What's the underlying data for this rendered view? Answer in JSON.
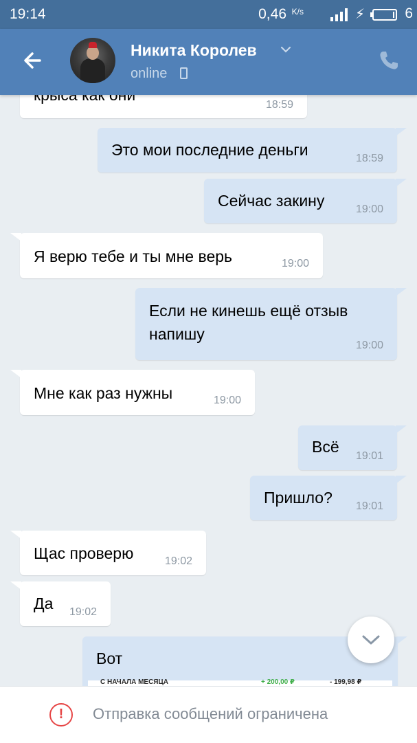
{
  "status_bar": {
    "time": "19:14",
    "net_speed": "0,46",
    "net_unit": "K/s",
    "battery_level": "6",
    "icons": [
      "signal-icon",
      "charging-icon",
      "battery-icon"
    ]
  },
  "header": {
    "contact_name": "Никита Королев",
    "presence": "online",
    "icons": [
      "back-arrow-icon",
      "chevron-down-icon",
      "mobile-icon",
      "phone-icon"
    ]
  },
  "messages": [
    {
      "dir": "in",
      "text": "крыса как они",
      "time": "18:59"
    },
    {
      "dir": "out",
      "text": "Это мои последние деньги",
      "time": "18:59"
    },
    {
      "dir": "out",
      "text": "Сейчас закину",
      "time": "19:00"
    },
    {
      "dir": "in",
      "text": "Я верю тебе и ты  мне верь",
      "time": "19:00"
    },
    {
      "dir": "out",
      "text_line1": "Если не кинешь ещё отзыв",
      "text_line2": "напишу",
      "time": "19:00"
    },
    {
      "dir": "in",
      "text": "Мне как раз нужны",
      "time": "19:00"
    },
    {
      "dir": "out",
      "text": "Всё",
      "time": "19:01"
    },
    {
      "dir": "out",
      "text": "Пришло?",
      "time": "19:01"
    },
    {
      "dir": "in",
      "text": "Щас проверю",
      "time": "19:02"
    },
    {
      "dir": "in",
      "text": "Да",
      "time": "19:02"
    },
    {
      "dir": "out",
      "text": "Вот",
      "receipt": {
        "col1": "С НАЧАЛА МЕСЯЦА",
        "col2": "+ 200,00 ₽",
        "col3": "- 199,98 ₽"
      }
    }
  ],
  "footer": {
    "notice": "Отправка сообщений ограничена",
    "icon": "warning-icon"
  },
  "colors": {
    "status_bar": "#446f9b",
    "header": "#5181b8",
    "chat_bg": "#e9eef2",
    "bubble_in": "#ffffff",
    "bubble_out": "#d6e4f4",
    "warning": "#e64646"
  }
}
